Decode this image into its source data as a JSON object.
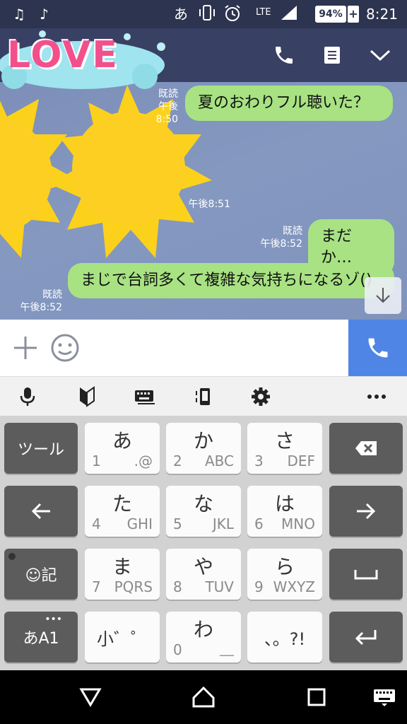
{
  "status_bar": {
    "ime_indicator": "あ",
    "network": "LTE",
    "battery": "94%",
    "time": "8:21"
  },
  "stickers": {
    "love_text": "LOVE"
  },
  "messages": [
    {
      "text": "夏のおわりフル聴いた？",
      "read": "既読",
      "time": "午後8:50"
    },
    {
      "text": "",
      "read": "",
      "time": "午後8:51"
    },
    {
      "text": "まだか…",
      "read": "既読",
      "time": "午後8:52"
    },
    {
      "text": "まじで台詞多くて複雑な気持ちになるゾ()",
      "read": "既読",
      "time": "午後8:52"
    }
  ],
  "keyboard": {
    "tool_key": "ツール",
    "emoji_key": "☺記",
    "mode_key": "あA1",
    "rows": [
      [
        {
          "kana": "あ",
          "num": "1",
          "sub": ".@"
        },
        {
          "kana": "か",
          "num": "2",
          "sub": "ABC"
        },
        {
          "kana": "さ",
          "num": "3",
          "sub": "DEF"
        }
      ],
      [
        {
          "kana": "た",
          "num": "4",
          "sub": "GHI"
        },
        {
          "kana": "な",
          "num": "5",
          "sub": "JKL"
        },
        {
          "kana": "は",
          "num": "6",
          "sub": "MNO"
        }
      ],
      [
        {
          "kana": "ま",
          "num": "7",
          "sub": "PQRS"
        },
        {
          "kana": "や",
          "num": "8",
          "sub": "TUV"
        },
        {
          "kana": "ら",
          "num": "9",
          "sub": "WXYZ"
        }
      ],
      [
        {
          "kana": "小゛゜",
          "num": "",
          "sub": ""
        },
        {
          "kana": "わ",
          "num": "0",
          "sub": "＿"
        },
        {
          "kana": "、。?!",
          "num": "",
          "sub": ""
        }
      ]
    ]
  },
  "colors": {
    "header": "#384063",
    "bubble": "#a8e283",
    "call_button": "#4f86e6"
  }
}
